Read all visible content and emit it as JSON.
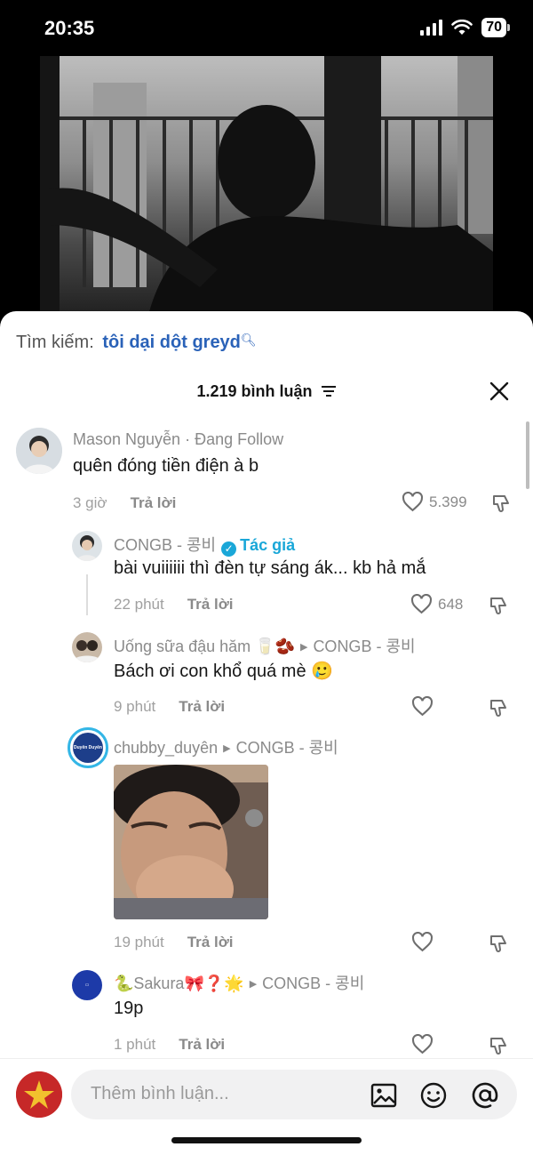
{
  "status": {
    "time": "20:35",
    "battery": "70"
  },
  "search": {
    "label": "Tìm kiếm:",
    "query": "tôi dại dột greyd"
  },
  "header": {
    "comment_count": "1.219 bình luận"
  },
  "comments": [
    {
      "user": "Mason Nguyễn · Đang Follow",
      "text": "quên đóng tiền điện à b",
      "time": "3 giờ",
      "reply": "Trả lời",
      "likes": "5.399"
    },
    {
      "user": "CONGB - 콩비",
      "author_tag": "Tác giả",
      "text": "bài vuiiiiii thì đèn tự sáng ák... kb hả mắ",
      "time": "22 phút",
      "reply": "Trả lời",
      "likes": "648"
    },
    {
      "user": "Uống sữa đậu hăm 🥛🫘",
      "reply_to": "CONGB - 콩비",
      "text": "Bách ơi con khổ quá mè 🥲",
      "time": "9 phút",
      "reply": "Trả lời"
    },
    {
      "user": "chubby_duyên",
      "reply_to": "CONGB - 콩비",
      "avatar_text": "Duyên Duyên",
      "time": "19 phút",
      "reply": "Trả lời"
    },
    {
      "user": "🐍Sakura🎀❓🌟",
      "reply_to": "CONGB - 콩비",
      "text": "19p",
      "time": "1 phút",
      "reply": "Trả lời"
    }
  ],
  "composer": {
    "placeholder": "Thêm bình luận..."
  },
  "colors": {
    "link": "#2a62b8",
    "author": "#1aa7d8",
    "muted": "#8a8a8a"
  }
}
